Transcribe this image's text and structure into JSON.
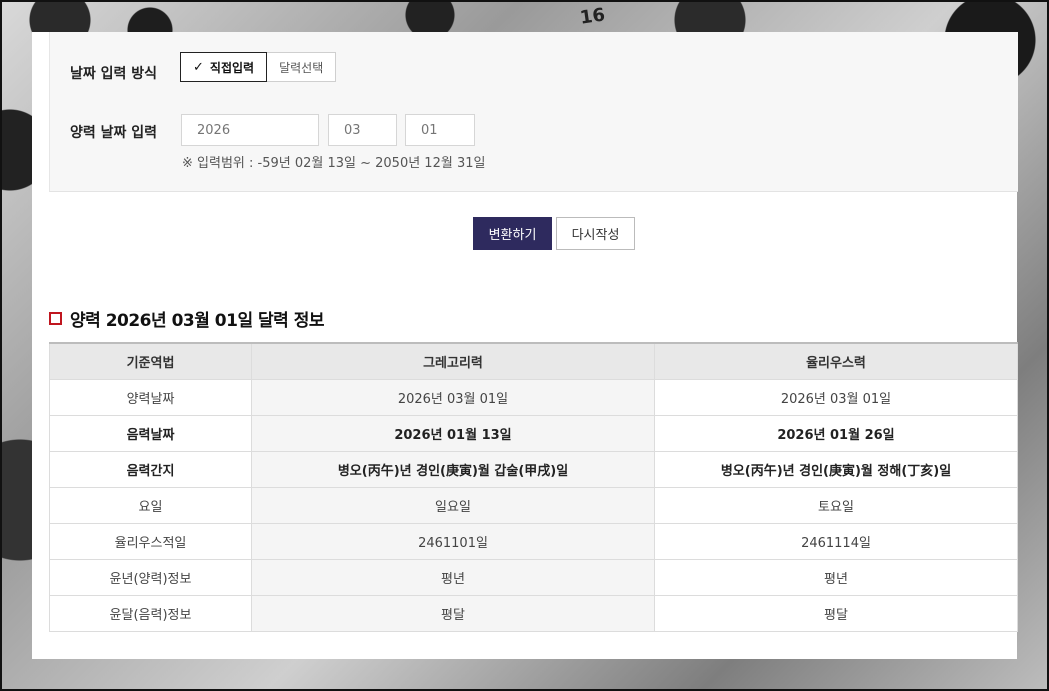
{
  "background_number": "16",
  "form": {
    "input_method_label": "날짜 입력 방식",
    "method_options": [
      {
        "label": "직접입력",
        "selected": true
      },
      {
        "label": "달력선택",
        "selected": false
      }
    ],
    "solar_date_label": "양력 날짜 입력",
    "year_value": "2026",
    "month_value": "03",
    "day_value": "01",
    "range_hint": "※ 입력범위 : -59년 02월 13일 ~ 2050년 12월 31일"
  },
  "actions": {
    "convert_label": "변환하기",
    "reset_label": "다시작성"
  },
  "result": {
    "title": "양력 2026년 03월 01일 달력 정보",
    "headers": [
      "기준역법",
      "그레고리력",
      "율리우스력"
    ],
    "rows": [
      {
        "label": "양력날짜",
        "gregorian": "2026년 03월 01일",
        "julian": "2026년 03월 01일",
        "bold": false
      },
      {
        "label": "음력날짜",
        "gregorian": "2026년 01월 13일",
        "julian": "2026년 01월 26일",
        "bold": true
      },
      {
        "label": "음력간지",
        "gregorian": "병오(丙午)년 경인(庚寅)월 갑술(甲戌)일",
        "julian": "병오(丙午)년 경인(庚寅)월 정해(丁亥)일",
        "bold": true
      },
      {
        "label": "요일",
        "gregorian": "일요일",
        "julian": "토요일",
        "bold": false
      },
      {
        "label": "율리우스적일",
        "gregorian": "2461101일",
        "julian": "2461114일",
        "bold": false
      },
      {
        "label": "윤년(양력)정보",
        "gregorian": "평년",
        "julian": "평년",
        "bold": false
      },
      {
        "label": "윤달(음력)정보",
        "gregorian": "평달",
        "julian": "평달",
        "bold": false
      }
    ]
  },
  "colors": {
    "primary_button": "#2e2a5e",
    "title_marker": "#c0161f"
  }
}
